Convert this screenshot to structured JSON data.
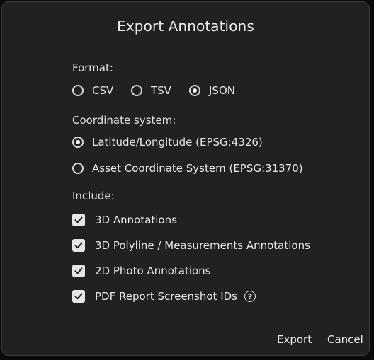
{
  "dialog": {
    "title": "Export Annotations",
    "format": {
      "label": "Format:",
      "options": [
        "CSV",
        "TSV",
        "JSON"
      ],
      "selected": "JSON"
    },
    "coordinate_system": {
      "label": "Coordinate system:",
      "options": [
        "Latitude/Longitude (EPSG:4326)",
        "Asset Coordinate System (EPSG:31370)"
      ],
      "selected": "Latitude/Longitude (EPSG:4326)"
    },
    "include": {
      "label": "Include:",
      "items": [
        {
          "label": "3D Annotations",
          "checked": true
        },
        {
          "label": "3D Polyline / Measurements Annotations",
          "checked": true
        },
        {
          "label": "2D Photo Annotations",
          "checked": true
        },
        {
          "label": "PDF Report Screenshot IDs",
          "checked": true,
          "help_icon": "help-circle-icon"
        }
      ]
    },
    "buttons": {
      "export_label": "Export",
      "cancel_label": "Cancel"
    }
  }
}
